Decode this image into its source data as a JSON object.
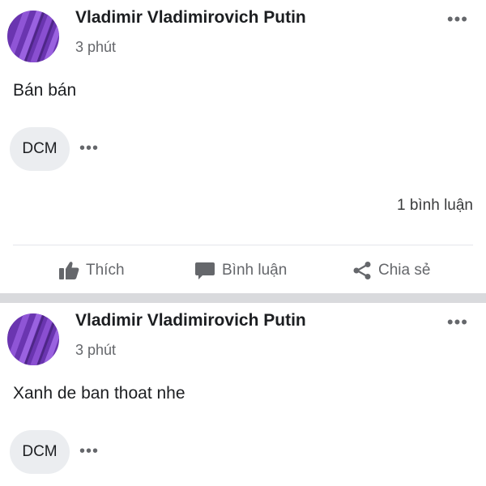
{
  "posts": [
    {
      "author": "Vladimir Vladimirovich Putin",
      "time": "3 phút",
      "text": "Bán bán",
      "comment_preview": "DCM",
      "comment_count": "1 bình luận",
      "actions": {
        "like": "Thích",
        "comment": "Bình luận",
        "share": "Chia sẻ"
      }
    },
    {
      "author": "Vladimir Vladimirovich Putin",
      "time": "3 phút",
      "text": "Xanh de ban thoat nhe",
      "comment_preview": "DCM"
    }
  ],
  "icons": {
    "more": "more-horizontal-icon",
    "like": "thumbs-up-icon",
    "comment": "comment-bubble-icon",
    "share": "share-icon"
  },
  "colors": {
    "avatar_purple": "#7b3fc0",
    "secondary_text": "#65676b",
    "chip_background": "#ebedf0",
    "separator": "#d9dadd"
  }
}
